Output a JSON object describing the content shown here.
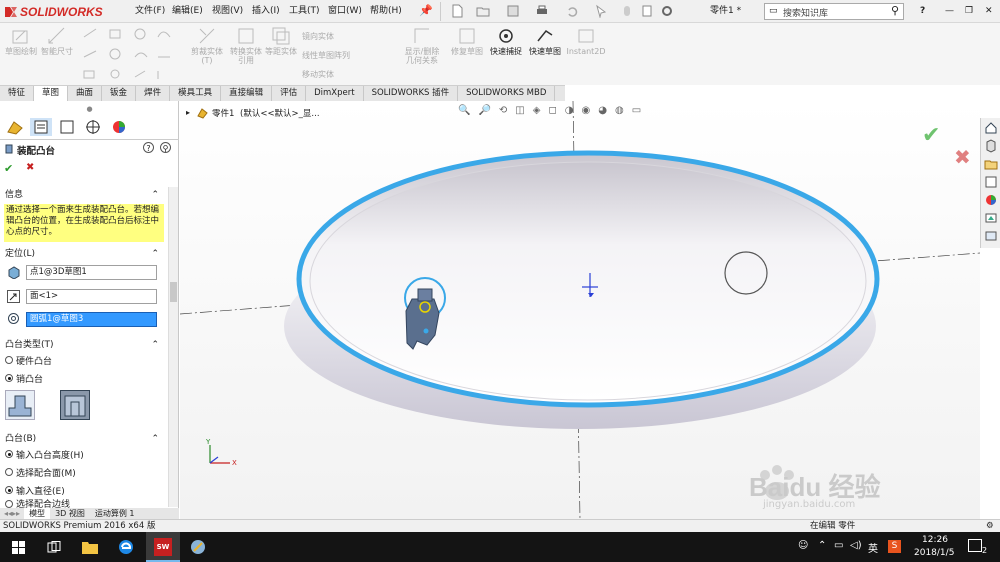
{
  "app": {
    "brand": "SOLIDWORKS",
    "menu": [
      "文件(F)",
      "编辑(E)",
      "视图(V)",
      "插入(I)",
      "工具(T)",
      "窗口(W)",
      "帮助(H)"
    ],
    "doc_title": "零件1 *",
    "search_placeholder": "搜索知识库",
    "help_label": "?"
  },
  "commands": {
    "sketch": "草图绘制",
    "smart_dim": "智能尺寸",
    "trim": "剪裁实体(T)",
    "convert": "转换实体引用",
    "offset": "等距实体",
    "mirror": "镜向实体",
    "linear_array": "线性草图阵列",
    "move": "移动实体",
    "display_relations": "显示/删除几何关系",
    "repair": "修复草图",
    "quick_snap": "快速捕捉",
    "rapid_sketch": "快速草图",
    "instant2d": "Instant2D"
  },
  "tabs": [
    "特征",
    "草图",
    "曲面",
    "钣金",
    "焊件",
    "模具工具",
    "直接编辑",
    "评估",
    "DimXpert",
    "SOLIDWORKS 插件",
    "SOLIDWORKS MBD"
  ],
  "active_tab": "草图",
  "property_manager": {
    "title": "装配凸台",
    "ok": "✔",
    "cancel": "✖",
    "info_header": "信息",
    "info_text": "通过选择一个面来生成装配凸台。若想编辑凸台的位置，在生成装配凸台后标注中心点的尺寸。",
    "position_header": "定位(L)",
    "fields": [
      "点1@3D草图1",
      "面<1>",
      "圆弧1@草图3"
    ],
    "boss_type_header": "凸台类型(T)",
    "boss_type_options": [
      {
        "label": "硬件凸台",
        "selected": false
      },
      {
        "label": "销凸台",
        "selected": true
      }
    ],
    "boss_header": "凸台(B)",
    "boss_options": [
      {
        "label": "输入凸台高度(H)",
        "selected": true
      },
      {
        "label": "选择配合面(M)",
        "selected": false
      },
      {
        "label": "输入直径(E)",
        "selected": true
      },
      {
        "label": "选择配合边线",
        "selected": false
      }
    ]
  },
  "tree": {
    "part_label": "零件1",
    "config": "(默认<<默认>_显..."
  },
  "bottom_tabs": [
    "模型",
    "3D 视图",
    "运动算例 1"
  ],
  "status": {
    "product": "SOLIDWORKS Premium 2016 x64 版",
    "editing": "在编辑 零件"
  },
  "taskbar": {
    "lang": "英",
    "time": "12:26",
    "date": "2018/1/5",
    "notifications": "2"
  },
  "watermark": {
    "brand": "Baidu 经验",
    "url": "jingyan.baidu.com"
  },
  "colors": {
    "accent": "#d32b27",
    "rim": "#3aa8e8",
    "info_bg": "#ffff80",
    "selection": "#3399ff"
  }
}
